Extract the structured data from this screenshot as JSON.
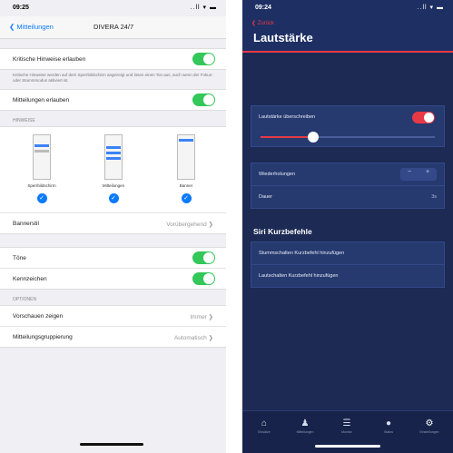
{
  "left": {
    "status": {
      "time": "09:25",
      "signal": "..ll  ▾  ▬"
    },
    "nav": {
      "back": "❮ Mitteilungen",
      "title": "DIVERA 24/7"
    },
    "settings": [
      {
        "label": "Kritische Hinweise erlauben",
        "toggle": true
      }
    ],
    "description": "Kritische Hinweise werden auf dem Sperrbildschirm angezeigt und lösen einen Ton aus, auch wenn der Fokus- oder Stummmodus aktiviert ist.",
    "row_allow": "Mitteilungen erlauben",
    "alerts_header": "HINWEISE",
    "alert_styles": [
      {
        "label": "Sperrbildschirm",
        "checked": true
      },
      {
        "label": "Mitteilungen",
        "checked": true
      },
      {
        "label": "Banner",
        "checked": true
      }
    ],
    "banner_style": {
      "label": "Bannerstil",
      "value": "Vorübergehend  ❯"
    },
    "sounds": {
      "label": "Töne",
      "toggle": true
    },
    "badges": {
      "label": "Kennzeichen",
      "toggle": true
    },
    "options_header": "OPTIONEN",
    "preview": {
      "label": "Vorschauen zeigen",
      "value": "Immer  ❯"
    },
    "grouping": {
      "label": "Mitteilungsgruppierung",
      "value": "Automatisch  ❯"
    }
  },
  "right": {
    "status": {
      "time": "09:24",
      "signal": "..ll  ▾  ▬"
    },
    "nav": {
      "back": "❮ Zurück",
      "title": "Lautstärke"
    },
    "override": {
      "label": "Lautstärke überschreiben",
      "toggle": true,
      "slider_fraction": 0.3
    },
    "repeat": {
      "label": "Wiederholungen",
      "minus": "−",
      "plus": "+"
    },
    "duration": {
      "label": "Dauer",
      "value": "3s"
    },
    "siri_header": "Siri Kurzbefehle",
    "siri_add": "Stummschalten Kurzbefehl hinzufügen",
    "siri_remove": "Lautschalten Kurzbefehl hinzufügen",
    "tabs": [
      {
        "icon": "⌂",
        "label": "Einsätze"
      },
      {
        "icon": "♟",
        "label": "Mitteilungen"
      },
      {
        "icon": "☰",
        "label": "Monitor"
      },
      {
        "icon": "●",
        "label": "Status"
      },
      {
        "icon": "⚙",
        "label": "Einstellungen"
      }
    ],
    "colors": {
      "accent": "#e63946",
      "background": "#1c2a54"
    }
  }
}
